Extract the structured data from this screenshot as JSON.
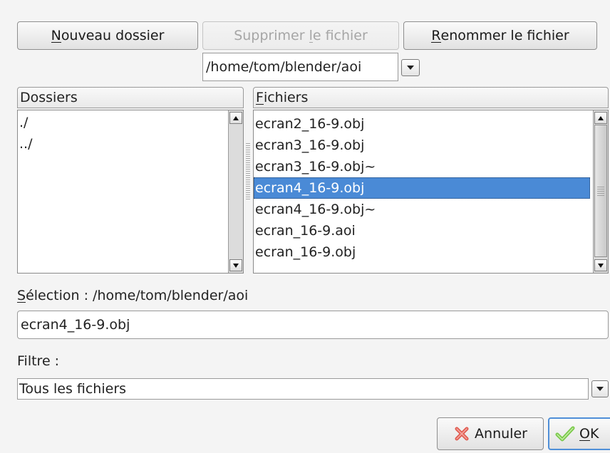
{
  "toolbar": {
    "new_folder": {
      "pre": "",
      "mnemonic": "N",
      "post": "ouveau dossier"
    },
    "delete_file": {
      "pre": "Supprimer ",
      "mnemonic": "l",
      "post": "e fichier"
    },
    "rename_file": {
      "pre": "",
      "mnemonic": "R",
      "post": "enommer le fichier"
    }
  },
  "path": {
    "value": "/home/tom/blender/aoi"
  },
  "folders": {
    "header": "Dossiers",
    "items": [
      "./",
      "../"
    ]
  },
  "files": {
    "header": {
      "pre": "",
      "mnemonic": "F",
      "post": "ichiers"
    },
    "items": [
      "ecran2_16-9.obj",
      "ecran3_16-9.obj",
      "ecran3_16-9.obj~",
      "ecran4_16-9.obj",
      "ecran4_16-9.obj~",
      "ecran_16-9.aoi",
      "ecran_16-9.obj"
    ],
    "selected_index": 3
  },
  "selection": {
    "label": {
      "pre": "",
      "mnemonic": "S",
      "post": "élection : /home/tom/blender/aoi"
    },
    "value": "ecran4_16-9.obj"
  },
  "filter": {
    "label": "Filtre :",
    "value": "Tous les fichiers"
  },
  "actions": {
    "cancel": {
      "label": "Annuler",
      "icon": "cancel-x-icon"
    },
    "ok": {
      "pre": "",
      "mnemonic": "O",
      "post": "K",
      "icon": "checkmark-icon"
    }
  },
  "colors": {
    "selection": "#4a8ad6",
    "cancel_icon": "#e05a4f",
    "ok_icon": "#7ac94a",
    "ok_border": "#4f8fd8"
  }
}
